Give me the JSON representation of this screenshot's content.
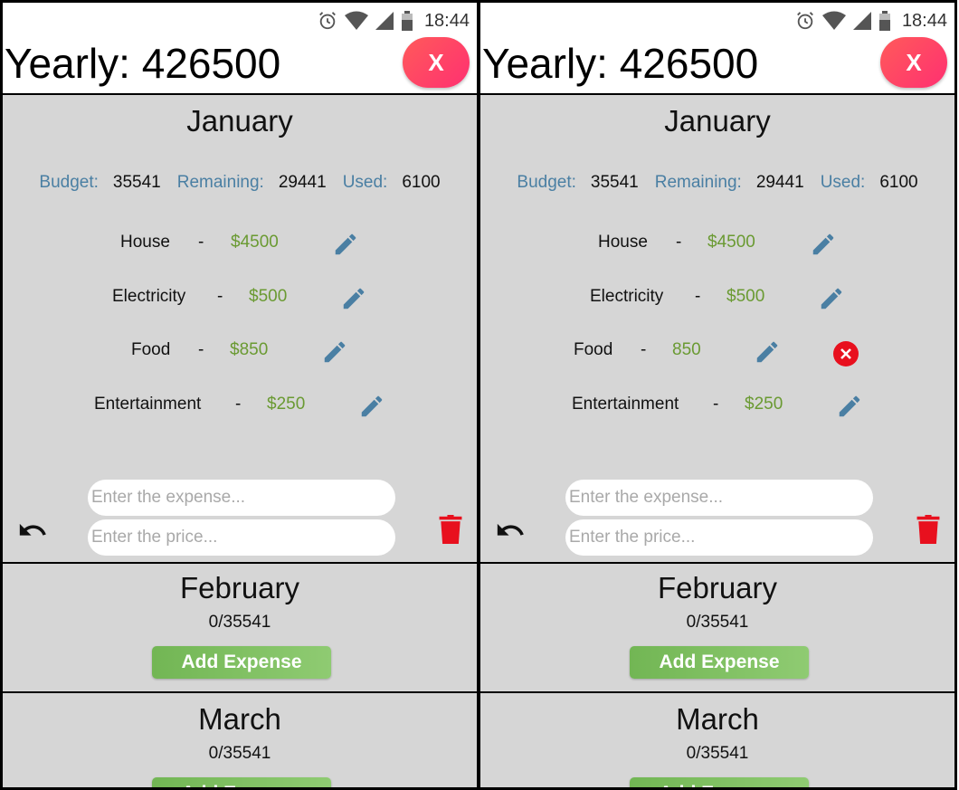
{
  "status_bar": {
    "time": "18:44"
  },
  "header": {
    "yearly_label": "Yearly: 426500",
    "close_label": "X"
  },
  "january": {
    "title": "January",
    "budget_label": "Budget:",
    "budget_value": "35541",
    "remaining_label": "Remaining:",
    "remaining_value": "29441",
    "used_label": "Used:",
    "used_value": "6100",
    "expenses_left": [
      {
        "name": "House",
        "dash": "-",
        "price": "$4500"
      },
      {
        "name": "Electricity",
        "dash": "-",
        "price": "$500"
      },
      {
        "name": "Food",
        "dash": "-",
        "price": "$850"
      },
      {
        "name": "Entertainment",
        "dash": "-",
        "price": "$250"
      }
    ],
    "expenses_right": [
      {
        "name": "House",
        "dash": "-",
        "price": "$4500"
      },
      {
        "name": "Electricity",
        "dash": "-",
        "price": "$500"
      },
      {
        "name": "Food",
        "dash": "-",
        "price": "850"
      },
      {
        "name": "Entertainment",
        "dash": "-",
        "price": "$250"
      }
    ],
    "expense_placeholder": "Enter the expense...",
    "price_placeholder": "Enter the price..."
  },
  "february": {
    "title": "February",
    "progress": "0/35541",
    "button": "Add Expense"
  },
  "march": {
    "title": "March",
    "progress": "0/35541",
    "button": "Add Expense"
  },
  "colors": {
    "label_blue": "#4a7fa3",
    "price_green": "#6a9a32",
    "close_red": "#ff3d63",
    "button_green": "#7fbf62",
    "trash_red": "#e8101e"
  }
}
